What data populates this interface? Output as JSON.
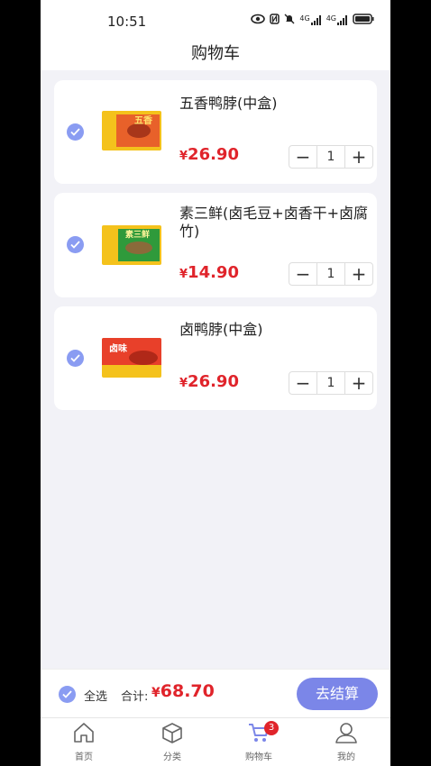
{
  "status": {
    "time": "10:51",
    "signal1": "4G",
    "signal2": "4G"
  },
  "header": {
    "title": "购物车"
  },
  "cart": {
    "items": [
      {
        "name": "五香鸭脖(中盒)",
        "currency": "¥",
        "price": "26.90",
        "qty": "1",
        "thumb_text": "五香",
        "thumb_color": "#e8612a"
      },
      {
        "name": "素三鲜(卤毛豆+卤香干+卤腐竹)",
        "currency": "¥",
        "price": "14.90",
        "qty": "1",
        "thumb_text": "素三鲜",
        "thumb_color": "#2f9a3b"
      },
      {
        "name": "卤鸭脖(中盒)",
        "currency": "¥",
        "price": "26.90",
        "qty": "1",
        "thumb_text": "卤味",
        "thumb_color": "#e8402a"
      }
    ]
  },
  "footer": {
    "select_all": "全选",
    "total_label": "合计:",
    "currency": "¥",
    "total": "68.70",
    "checkout": "去结算"
  },
  "tabs": [
    {
      "label": "首页",
      "icon": "home-icon"
    },
    {
      "label": "分类",
      "icon": "box-icon"
    },
    {
      "label": "购物车",
      "icon": "cart-icon",
      "badge": "3",
      "active": true
    },
    {
      "label": "我的",
      "icon": "user-icon"
    }
  ],
  "colors": {
    "accent": "#7b86e8",
    "price": "#e0242b",
    "check": "#8a9cf2"
  }
}
